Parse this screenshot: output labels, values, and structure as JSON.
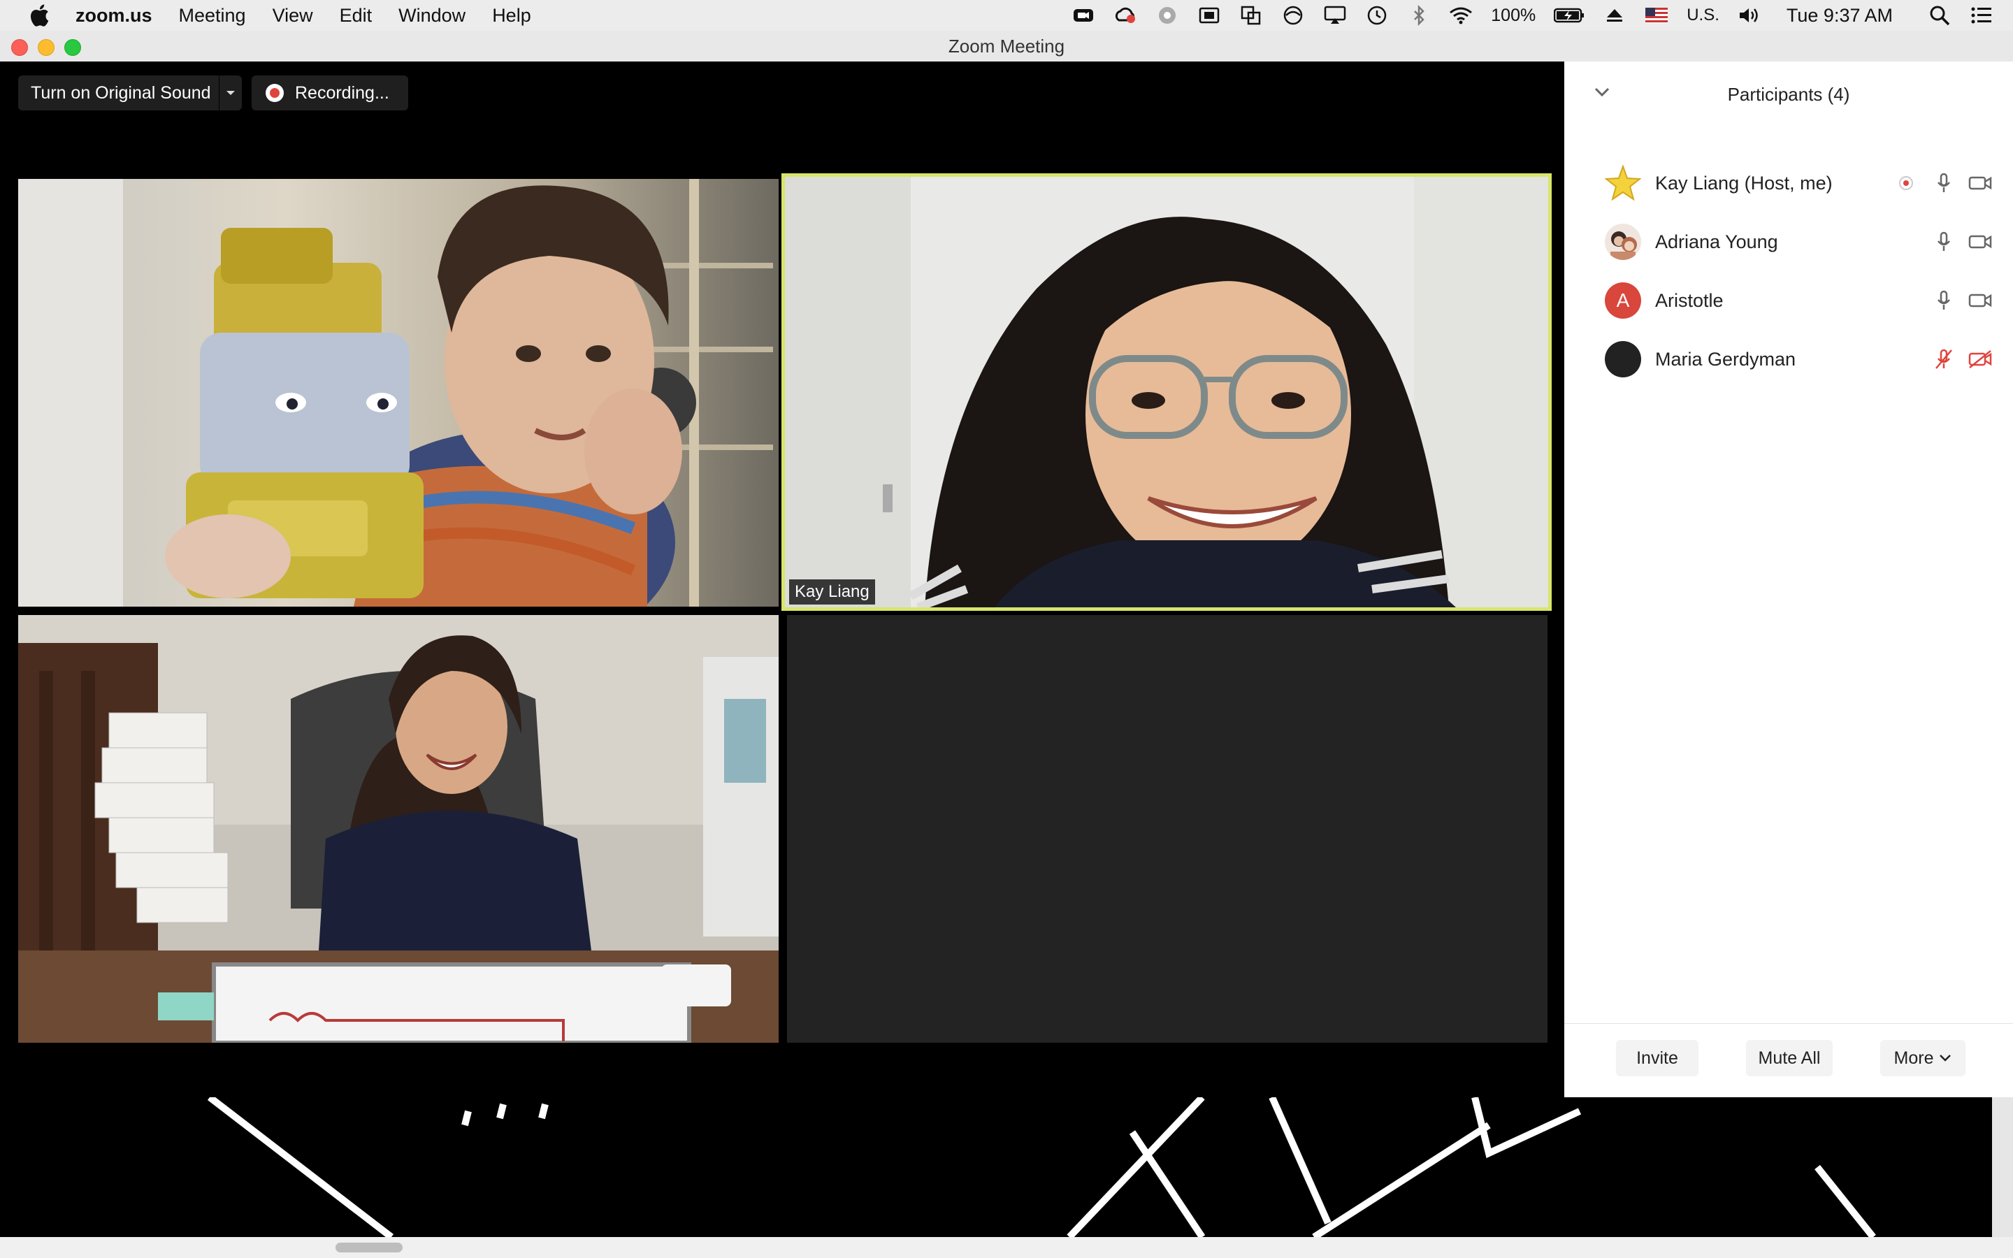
{
  "menubar": {
    "app": "zoom.us",
    "items": [
      "Meeting",
      "View",
      "Edit",
      "Window",
      "Help"
    ],
    "battery": "100%",
    "input_source": "U.S.",
    "clock": "Tue 9:37 AM"
  },
  "window": {
    "title": "Zoom Meeting"
  },
  "toolbar": {
    "original_sound": "Turn on Original Sound",
    "recording": "Recording..."
  },
  "video": {
    "active_speaker_label": "Kay Liang"
  },
  "participants": {
    "title": "Participants (4)",
    "list": [
      {
        "name": "Kay Liang (Host, me)",
        "avatar": "star-avatar",
        "recording": true,
        "mic": "on",
        "video": "on"
      },
      {
        "name": "Adriana Young",
        "avatar": "photo-avatar",
        "mic": "on",
        "video": "on"
      },
      {
        "name": "Aristotle",
        "avatar_letter": "A",
        "avatar_color": "#d9463c",
        "mic": "on",
        "video": "on"
      },
      {
        "name": "Maria Gerdyman",
        "avatar_color": "#222222",
        "mic": "muted",
        "video": "off"
      }
    ],
    "buttons": {
      "invite": "Invite",
      "mute_all": "Mute All",
      "more": "More"
    }
  },
  "colors": {
    "active_speaker_border": "#d8e66a",
    "muted_red": "#e0443e",
    "record_red": "#e0443e"
  }
}
